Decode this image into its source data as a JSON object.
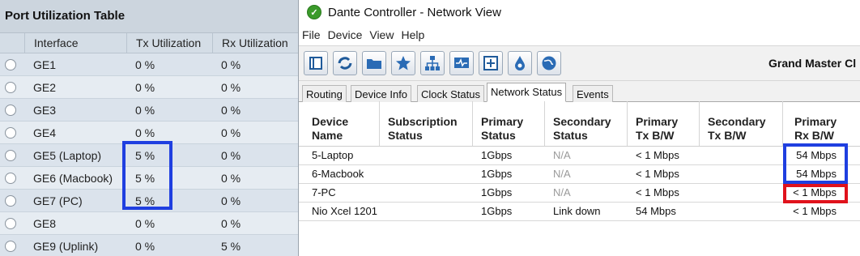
{
  "port_table": {
    "title": "Port Utilization Table",
    "columns": [
      "Interface",
      "Tx Utilization",
      "Rx Utilization"
    ],
    "rows": [
      {
        "interface": "GE1",
        "tx": "0 %",
        "rx": "0 %"
      },
      {
        "interface": "GE2",
        "tx": "0 %",
        "rx": "0 %"
      },
      {
        "interface": "GE3",
        "tx": "0 %",
        "rx": "0 %"
      },
      {
        "interface": "GE4",
        "tx": "0 %",
        "rx": "0 %"
      },
      {
        "interface": "GE5 (Laptop)",
        "tx": "5 %",
        "rx": "0 %"
      },
      {
        "interface": "GE6 (Macbook)",
        "tx": "5 %",
        "rx": "0 %"
      },
      {
        "interface": "GE7 (PC)",
        "tx": "5 %",
        "rx": "0 %"
      },
      {
        "interface": "GE8",
        "tx": "0 %",
        "rx": "0 %"
      },
      {
        "interface": "GE9 (Uplink)",
        "tx": "0 %",
        "rx": "5 %"
      }
    ]
  },
  "window": {
    "title": "Dante Controller - Network View",
    "menu": [
      "File",
      "Device",
      "View",
      "Help"
    ],
    "toolbar_icons": [
      "panel-icon",
      "refresh-icon",
      "folder-icon",
      "star-icon",
      "network-icon",
      "monitor-icon",
      "add-icon",
      "drop-icon",
      "globe-icon"
    ],
    "grand_master_label": "Grand Master Cl",
    "tabs": [
      "Routing",
      "Device Info",
      "Clock Status",
      "Network Status",
      "Events"
    ],
    "active_tab": "Network Status",
    "grid": {
      "headers": [
        [
          "Device",
          "Name"
        ],
        [
          "Subscription",
          "Status"
        ],
        [
          "Primary",
          "Status"
        ],
        [
          "Secondary",
          "Status"
        ],
        [
          "Primary",
          "Tx B/W"
        ],
        [
          "Secondary",
          "Tx B/W"
        ],
        [
          "Primary",
          "Rx B/W"
        ]
      ],
      "rows": [
        {
          "device": "5-Laptop",
          "subscription": "",
          "primary_status": "1Gbps",
          "secondary_status": "N/A",
          "primary_tx": "< 1 Mbps",
          "secondary_tx": "",
          "primary_rx": "54 Mbps"
        },
        {
          "device": "6-Macbook",
          "subscription": "",
          "primary_status": "1Gbps",
          "secondary_status": "N/A",
          "primary_tx": "< 1 Mbps",
          "secondary_tx": "",
          "primary_rx": "54 Mbps"
        },
        {
          "device": "7-PC",
          "subscription": "",
          "primary_status": "1Gbps",
          "secondary_status": "N/A",
          "primary_tx": "< 1 Mbps",
          "secondary_tx": "",
          "primary_rx": "< 1 Mbps"
        },
        {
          "device": "Nio Xcel 1201",
          "subscription": "",
          "primary_status": "1Gbps",
          "secondary_status": "Link down",
          "primary_tx": "54 Mbps",
          "secondary_tx": "",
          "primary_rx": "< 1 Mbps"
        }
      ]
    }
  },
  "highlights": {
    "tx_box_color": "#1f3fe0",
    "rx_box_color": "#1f3fe0",
    "pc_rx_box_color": "#e0121c"
  }
}
